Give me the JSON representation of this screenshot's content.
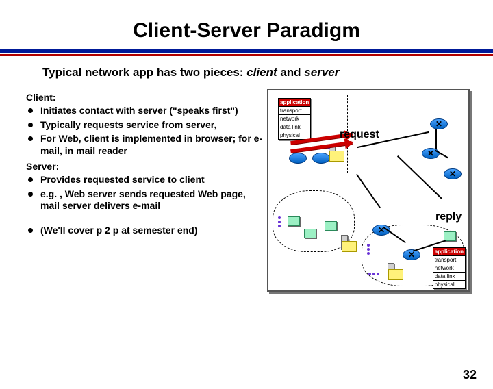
{
  "title": "Client-Server Paradigm",
  "subtitle_pre": "Typical network app has two pieces: ",
  "subtitle_client": "client",
  "subtitle_mid": " and ",
  "subtitle_server": "server",
  "client_heading": "Client:",
  "client_bullets": [
    "Initiates contact with server (\"speaks first\")",
    "Typically requests service from server,",
    "For Web, client is implemented in browser; for e-mail, in mail reader"
  ],
  "server_heading": "Server:",
  "server_bullets": [
    "Provides requested service to client",
    "e.g. , Web server sends requested Web page, mail server delivers e-mail"
  ],
  "extra_bullet": "(We'll cover p 2 p at semester end)",
  "stack_layers": {
    "application": "application",
    "transport": "transport",
    "network": "network",
    "datalink": "data link",
    "physical": "physical"
  },
  "label_request": "request",
  "label_reply": "reply",
  "page_number": "32"
}
